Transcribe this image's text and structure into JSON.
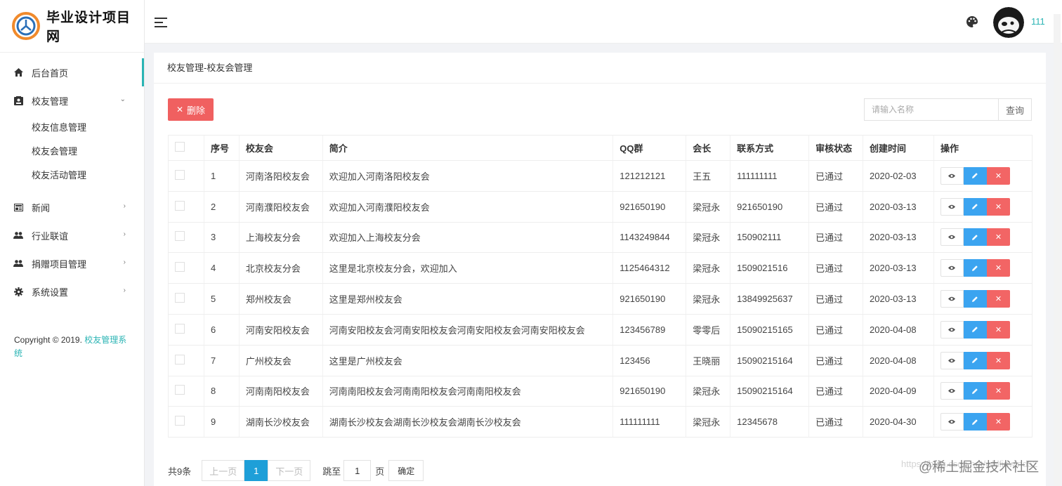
{
  "brand": {
    "title": "毕业设计项目网",
    "accent_color": "#2ab4b4"
  },
  "sidebar": {
    "items": [
      {
        "label": "后台首页",
        "icon": "home-icon",
        "active": true
      },
      {
        "label": "校友管理",
        "icon": "contact-card-icon",
        "expanded": true,
        "children": [
          {
            "label": "校友信息管理"
          },
          {
            "label": "校友会管理"
          },
          {
            "label": "校友活动管理"
          }
        ]
      },
      {
        "label": "新闻",
        "icon": "news-icon"
      },
      {
        "label": "行业联谊",
        "icon": "people-icon"
      },
      {
        "label": "捐赠项目管理",
        "icon": "people-icon"
      },
      {
        "label": "系统设置",
        "icon": "gear-icon"
      }
    ],
    "copyright_prefix": "Copyright © 2019.",
    "copyright_link": "校友管理系统"
  },
  "header": {
    "username": "111"
  },
  "breadcrumb": "校友管理-校友会管理",
  "toolbar": {
    "delete_label": "删除",
    "search_placeholder": "请输入名称",
    "search_label": "查询"
  },
  "table": {
    "columns": [
      "序号",
      "校友会",
      "简介",
      "QQ群",
      "会长",
      "联系方式",
      "审核状态",
      "创建时间",
      "操作"
    ],
    "rows": [
      [
        "1",
        "河南洛阳校友会",
        "欢迎加入河南洛阳校友会",
        "121212121",
        "王五",
        "111111111",
        "已通过",
        "2020-02-03"
      ],
      [
        "2",
        "河南濮阳校友会",
        "欢迎加入河南濮阳校友会",
        "921650190",
        "梁冠永",
        "921650190",
        "已通过",
        "2020-03-13"
      ],
      [
        "3",
        "上海校友分会",
        "欢迎加入上海校友分会",
        "1143249844",
        "梁冠永",
        "150902111",
        "已通过",
        "2020-03-13"
      ],
      [
        "4",
        "北京校友分会",
        "这里是北京校友分会，欢迎加入",
        "1125464312",
        "梁冠永",
        "1509021516",
        "已通过",
        "2020-03-13"
      ],
      [
        "5",
        "郑州校友会",
        "这里是郑州校友会",
        "921650190",
        "梁冠永",
        "13849925637",
        "已通过",
        "2020-03-13"
      ],
      [
        "6",
        "河南安阳校友会",
        "河南安阳校友会河南安阳校友会河南安阳校友会河南安阳校友会",
        "123456789",
        "零零后",
        "15090215165",
        "已通过",
        "2020-04-08"
      ],
      [
        "7",
        "广州校友会",
        "这里是广州校友会",
        "123456",
        "王晓丽",
        "15090215164",
        "已通过",
        "2020-04-08"
      ],
      [
        "8",
        "河南南阳校友会",
        "河南南阳校友会河南南阳校友会河南南阳校友会",
        "921650190",
        "梁冠永",
        "15090215164",
        "已通过",
        "2020-04-09"
      ],
      [
        "9",
        "湖南长沙校友会",
        "湖南长沙校友会湖南长沙校友会湖南长沙校友会",
        "111111111",
        "梁冠永",
        "12345678",
        "已通过",
        "2020-04-30"
      ]
    ]
  },
  "pagination": {
    "total": "共9条",
    "prev": "上一页",
    "current": "1",
    "next": "下一页",
    "jump_label": "跳至",
    "jump_value": "1",
    "unit": "页",
    "confirm": "确定"
  },
  "watermark": {
    "url": "https://blog.csdn.net/whlfinwind52",
    "brand": "@稀土掘金技术社区"
  }
}
